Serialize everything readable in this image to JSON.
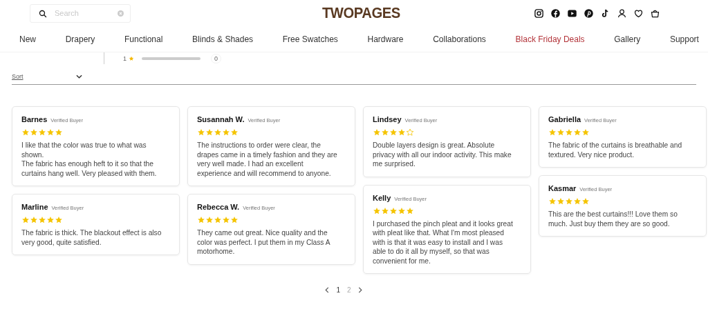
{
  "header": {
    "search": {
      "placeholder": "Search"
    },
    "logo": "TWOPAGES"
  },
  "nav": [
    {
      "label": "New",
      "highlighted": false
    },
    {
      "label": "Drapery",
      "highlighted": false
    },
    {
      "label": "Functional",
      "highlighted": false
    },
    {
      "label": "Blinds & Shades",
      "highlighted": false
    },
    {
      "label": "Free Swatches",
      "highlighted": false
    },
    {
      "label": "Hardware",
      "highlighted": false
    },
    {
      "label": "Collaborations",
      "highlighted": false
    },
    {
      "label": "Black Friday Deals",
      "highlighted": true
    },
    {
      "label": "Gallery",
      "highlighted": false
    },
    {
      "label": "Support",
      "highlighted": false
    }
  ],
  "rating_row": {
    "label": "1",
    "level": 0,
    "count": "0"
  },
  "sort": {
    "label": "Sort"
  },
  "columns": [
    {
      "reviews": [
        {
          "name": "Barnes",
          "badge": "Verified Buyer",
          "stars": 5,
          "text": "I like that the color was true to what was shown.\nThe fabric has enough heft to it so that the curtains hang well. Very pleased with them."
        },
        {
          "name": "Marline",
          "badge": "Verified Buyer",
          "stars": 5,
          "text": "The fabric is thick. The blackout effect is also very good, quite satisfied."
        }
      ]
    },
    {
      "reviews": [
        {
          "name": "Susannah W.",
          "badge": "Verified Buyer",
          "stars": 5,
          "text": "The instructions to order were clear, the drapes came in a timely fashion and they are very well made. I had an excellent experience and will recommend to anyone."
        },
        {
          "name": "Rebecca W.",
          "badge": "Verified Buyer",
          "stars": 5,
          "text": "They came out great. Nice quality and the color was perfect. I put them in my Class A motorhome."
        }
      ]
    },
    {
      "reviews": [
        {
          "name": "Lindsey",
          "badge": "Verified Buyer",
          "stars": 4,
          "text": "Double layers design is great. Absolute privacy with all our indoor activity. This make me surprised."
        },
        {
          "name": "Kelly",
          "badge": "Verified Buyer",
          "stars": 5,
          "text": "I purchased the pinch pleat and it looks great with pleat like that. What I'm most pleased with is that it was easy to install and I was able to do it all by myself, so that was convenient for me."
        }
      ]
    },
    {
      "reviews": [
        {
          "name": "Gabriella",
          "badge": "Verified Buyer",
          "stars": 5,
          "text": "The fabric of the curtains is breathable and textured. Very nice product."
        },
        {
          "name": "Kasmar",
          "badge": "Verified Buyer",
          "stars": 5,
          "text": "This are the best curtains!!! Love them so much. Just buy them they are so good."
        }
      ]
    }
  ],
  "pagination": [
    {
      "label": "1",
      "selected": true
    },
    {
      "label": "2",
      "selected": false
    }
  ]
}
